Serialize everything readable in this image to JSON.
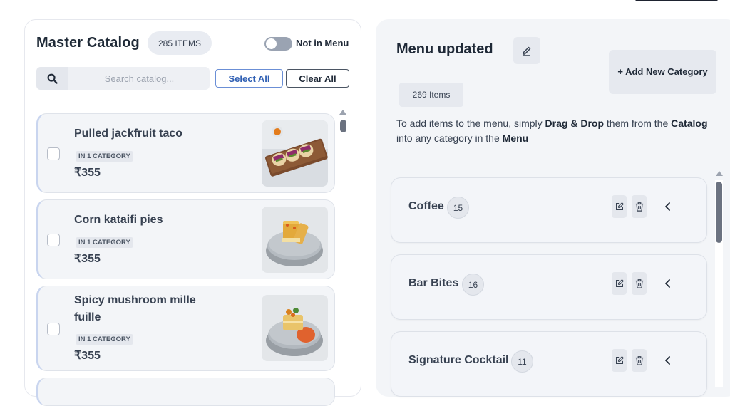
{
  "catalog": {
    "title": "Master Catalog",
    "count_label": "285 ITEMS",
    "toggle_label": "Not in Menu",
    "search_placeholder": "Search catalog...",
    "select_all_label": "Select All",
    "clear_all_label": "Clear All",
    "items": [
      {
        "name": "Pulled jackfruit taco",
        "category_badge": "IN 1 CATEGORY",
        "price": "₹355",
        "image_icon": "taco-photo"
      },
      {
        "name": "Corn kataifi pies",
        "category_badge": "IN 1 CATEGORY",
        "price": "₹355",
        "image_icon": "pie-photo"
      },
      {
        "name": "Spicy mushroom mille fuille",
        "category_badge": "IN 1 CATEGORY",
        "price": "₹355",
        "image_icon": "mille-fuille-photo"
      }
    ]
  },
  "menu": {
    "title": "Menu updated",
    "add_category_label": "+ Add New Category",
    "count_label": "269 Items",
    "help_prefix": "To add items to the menu, simply ",
    "help_bold1": "Drag & Drop",
    "help_middle": " them from the ",
    "help_bold2": "Catalog",
    "help_middle2": " into any category in the ",
    "help_bold3": "Menu",
    "categories": [
      {
        "name": "Coffee",
        "count": "15"
      },
      {
        "name": "Bar Bites",
        "count": "16"
      },
      {
        "name": "Signature Cocktail",
        "count": "11"
      }
    ]
  },
  "colors": {
    "accent_blue": "#2f5fb3",
    "panel_bg": "#f3f5f8",
    "text_dark": "#1f2937"
  }
}
